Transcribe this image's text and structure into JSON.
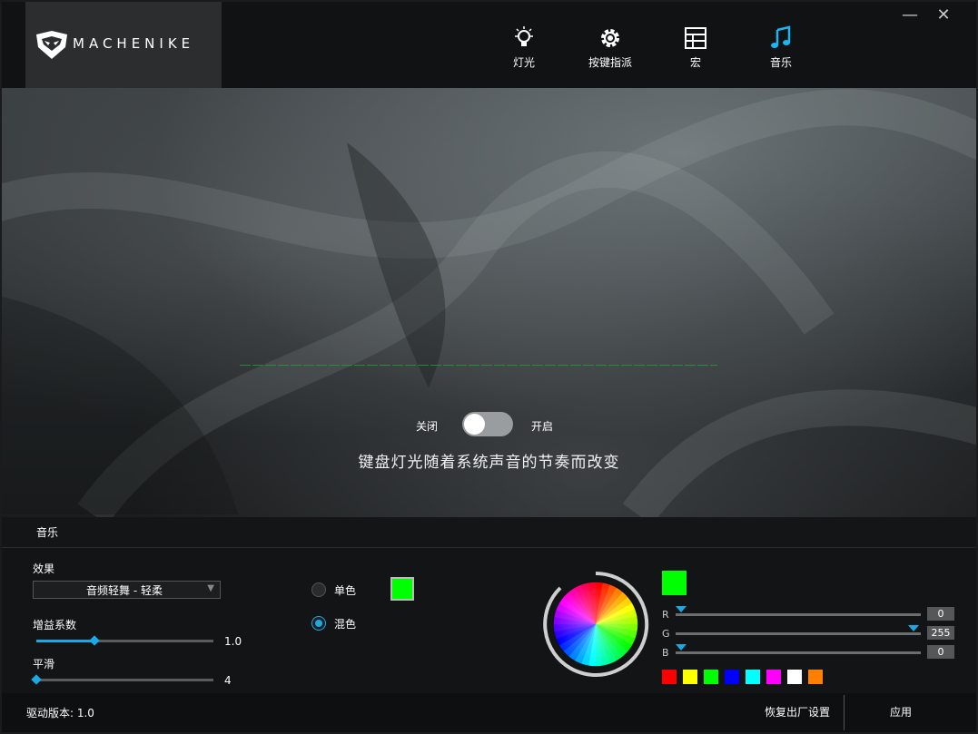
{
  "brand": {
    "name": "MACHENIKE"
  },
  "nav": [
    {
      "label": "灯光",
      "icon": "bulb-icon"
    },
    {
      "label": "按键指派",
      "icon": "gear-icon"
    },
    {
      "label": "宏",
      "icon": "grid-icon"
    },
    {
      "label": "音乐",
      "icon": "music-note-icon",
      "active": true
    }
  ],
  "window": {
    "minimize": "—",
    "close": "✕"
  },
  "hero": {
    "toggle_off": "关闭",
    "toggle_on": "开启",
    "toggle_state": false,
    "description": "键盘灯光随着系统声音的节奏而改变"
  },
  "section": {
    "title": "音乐"
  },
  "panel": {
    "effect_label": "效果",
    "effect_value": "音频轻舞 - 轻柔",
    "gain_label": "增益系数",
    "gain_value": "1.0",
    "gain_fraction": 0.33,
    "smooth_label": "平滑",
    "smooth_value": "4",
    "smooth_fraction": 0.0,
    "mode_single": "单色",
    "mode_mixed": "混色",
    "mode_selected": "混色",
    "single_color": "#00ff00"
  },
  "color": {
    "current": "#00ff00",
    "r_label": "R",
    "r_value": "0",
    "g_label": "G",
    "g_value": "255",
    "b_label": "B",
    "b_value": "0",
    "presets": [
      "#ff0000",
      "#ffff00",
      "#00ff00",
      "#0000ff",
      "#00ffff",
      "#ff00ff",
      "#ffffff",
      "#ff8000"
    ]
  },
  "footer": {
    "version": "驱动版本: 1.0",
    "reset": "恢复出厂设置",
    "apply": "应用"
  }
}
